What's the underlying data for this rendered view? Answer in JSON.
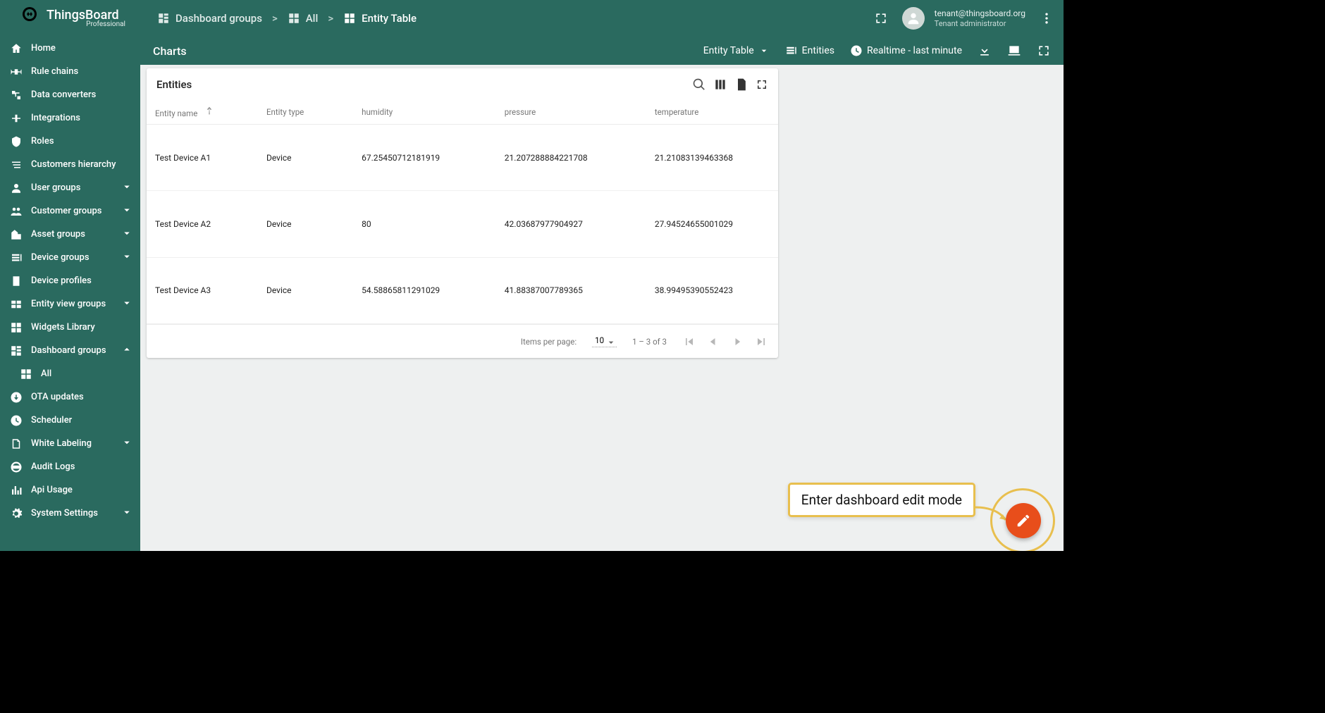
{
  "brand": {
    "name": "ThingsBoard",
    "edition": "Professional"
  },
  "user": {
    "email": "tenant@thingsboard.org",
    "role": "Tenant administrator"
  },
  "breadcrumb": {
    "items": [
      {
        "label": "Dashboard groups"
      },
      {
        "label": "All"
      },
      {
        "label": "Entity Table"
      }
    ],
    "sep": ">"
  },
  "toolbar": {
    "title": "Charts",
    "layout_select": "Entity Table",
    "entities_label": "Entities",
    "time_label": "Realtime - last minute"
  },
  "sidebar": {
    "items": [
      {
        "label": "Home"
      },
      {
        "label": "Rule chains"
      },
      {
        "label": "Data converters"
      },
      {
        "label": "Integrations"
      },
      {
        "label": "Roles"
      },
      {
        "label": "Customers hierarchy"
      },
      {
        "label": "User groups",
        "expandable": true
      },
      {
        "label": "Customer groups",
        "expandable": true
      },
      {
        "label": "Asset groups",
        "expandable": true
      },
      {
        "label": "Device groups",
        "expandable": true
      },
      {
        "label": "Device profiles"
      },
      {
        "label": "Entity view groups",
        "expandable": true
      },
      {
        "label": "Widgets Library"
      },
      {
        "label": "Dashboard groups",
        "expandable": true,
        "open": true,
        "children": [
          {
            "label": "All"
          }
        ]
      },
      {
        "label": "OTA updates"
      },
      {
        "label": "Scheduler"
      },
      {
        "label": "White Labeling",
        "expandable": true
      },
      {
        "label": "Audit Logs"
      },
      {
        "label": "Api Usage"
      },
      {
        "label": "System Settings",
        "expandable": true
      }
    ]
  },
  "widget": {
    "title": "Entities",
    "columns": [
      "Entity name",
      "Entity type",
      "humidity",
      "pressure",
      "temperature"
    ],
    "rows": [
      {
        "name": "Test Device A1",
        "type": "Device",
        "humidity": "67.25450712181919",
        "pressure": "21.207288884221708",
        "temperature": "21.21083139463368"
      },
      {
        "name": "Test Device A2",
        "type": "Device",
        "humidity": "80",
        "pressure": "42.03687977904927",
        "temperature": "27.94524655001029"
      },
      {
        "name": "Test Device A3",
        "type": "Device",
        "humidity": "54.58865811291029",
        "pressure": "41.88387007789365",
        "temperature": "38.99495390552423"
      }
    ],
    "pager": {
      "items_per_page_label": "Items per page:",
      "page_size": "10",
      "range": "1 – 3 of 3"
    }
  },
  "callout": {
    "text": "Enter dashboard edit mode"
  }
}
